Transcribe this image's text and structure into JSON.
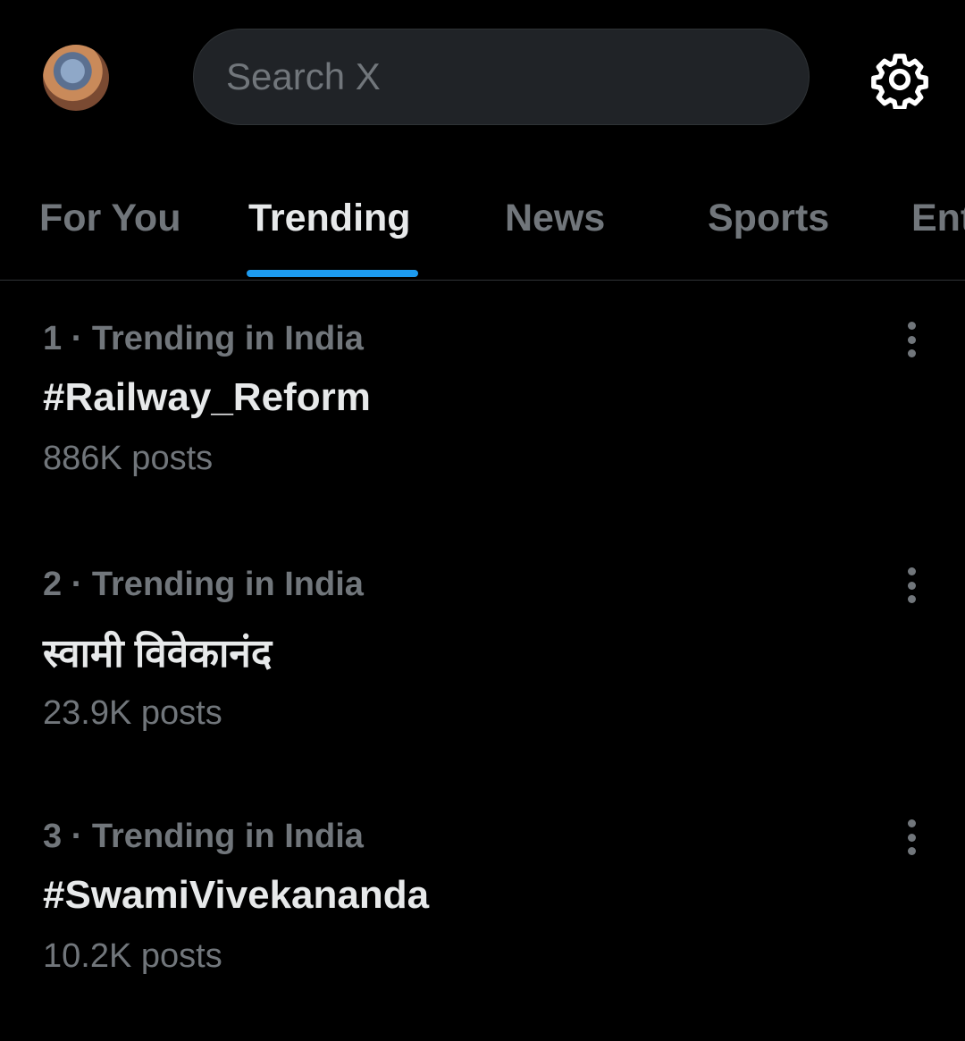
{
  "header": {
    "search_placeholder": "Search X",
    "avatar_icon": "profile-avatar",
    "settings_icon": "gear-icon"
  },
  "tabs": [
    {
      "label": "For You",
      "active": false
    },
    {
      "label": "Trending",
      "active": true
    },
    {
      "label": "News",
      "active": false
    },
    {
      "label": "Sports",
      "active": false
    },
    {
      "label": "Ent",
      "active": false
    }
  ],
  "trends": [
    {
      "meta": "1 · Trending in India",
      "name": "#Railway_Reform",
      "count": "886K posts"
    },
    {
      "meta": "2 · Trending in India",
      "name": "स्वामी विवेकानंद",
      "count": "23.9K posts"
    },
    {
      "meta": "3 · Trending in India",
      "name": "#SwamiVivekananda",
      "count": "10.2K posts"
    }
  ],
  "colors": {
    "background": "#000000",
    "accent": "#1d9bf0",
    "text_primary": "#e7e9ea",
    "text_secondary": "#71767b",
    "search_bg": "#202327"
  }
}
